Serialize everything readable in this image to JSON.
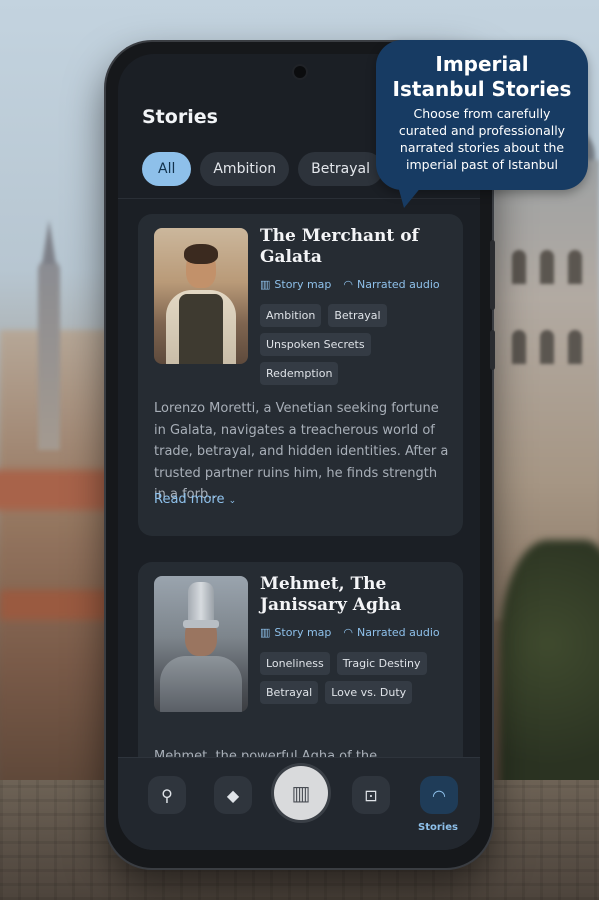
{
  "bubble": {
    "title_line1": "Imperial",
    "title_line2": "Istanbul Stories",
    "text": "Choose from carefully curated and professionally narrated stories about the imperial past of Istanbul"
  },
  "screen": {
    "title": "Stories"
  },
  "chips": [
    "All",
    "Ambition",
    "Betrayal"
  ],
  "stories": [
    {
      "title": "The Merchant of Galata",
      "story_map": "Story map",
      "narrated": "Narrated audio",
      "tags": [
        "Ambition",
        "Betrayal",
        "Unspoken Secrets",
        "Redemption"
      ],
      "description": "Lorenzo Moretti, a Venetian seeking fortune in Galata, navigates a treacherous world of trade, betrayal, and hidden identities. After a trusted partner ruins him, he finds strength in a forb...",
      "read_more": "Read more"
    },
    {
      "title": "Mehmet, The Janissary Agha",
      "story_map": "Story map",
      "narrated": "Narrated audio",
      "tags": [
        "Loneliness",
        "Tragic Destiny",
        "Betrayal",
        "Love vs. Duty"
      ],
      "description": "Mehmet, the powerful Agha of the Janissaries,"
    }
  ],
  "nav": {
    "active_label": "Stories"
  },
  "colors": {
    "accent": "#8ec0ea",
    "bubble": "#173b63",
    "surface": "#262c33"
  }
}
